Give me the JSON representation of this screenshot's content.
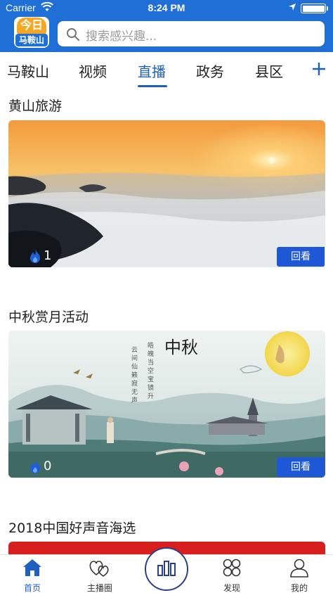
{
  "status": {
    "carrier": "Carrier",
    "time": "8:24 PM"
  },
  "logo": {
    "top_text": "今日",
    "bottom_text": "马鞍山"
  },
  "search": {
    "placeholder": "搜索感兴趣..."
  },
  "tabs": [
    {
      "label": "马鞍山",
      "active": false
    },
    {
      "label": "视频",
      "active": false
    },
    {
      "label": "直播",
      "active": true
    },
    {
      "label": "政务",
      "active": false
    },
    {
      "label": "县区",
      "active": false
    }
  ],
  "feed": [
    {
      "title": "黄山旅游",
      "count": "1",
      "action": "回看"
    },
    {
      "title": "中秋赏月活动",
      "count": "0",
      "action": "回看"
    },
    {
      "title": "2018中国好声音海选"
    }
  ],
  "artwork_text": {
    "calligraphy_title": "中秋"
  },
  "bottom_nav": [
    {
      "label": "首页",
      "icon": "home-icon",
      "active": true
    },
    {
      "label": "主播圈",
      "icon": "hearts-icon",
      "active": false
    },
    {
      "label": "",
      "icon": "bar-chart-icon",
      "active": false
    },
    {
      "label": "发现",
      "icon": "discover-icon",
      "active": false
    },
    {
      "label": "我的",
      "icon": "user-icon",
      "active": false
    }
  ],
  "colors": {
    "brand_blue": "#1f6fd6",
    "active_blue": "#1f5fbf",
    "button_blue": "#1f58d6"
  }
}
